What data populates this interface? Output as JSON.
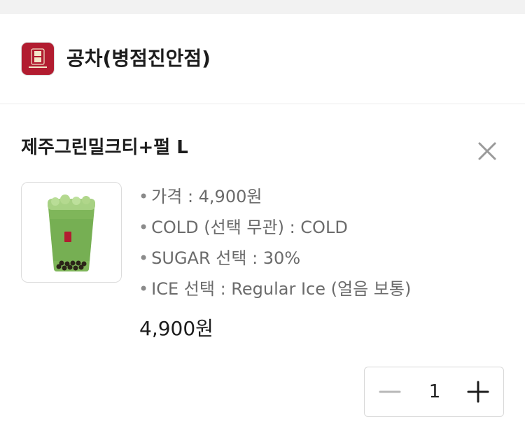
{
  "store": {
    "name": "공차(병점진안점)",
    "logo_icon": "gongcha-logo-icon",
    "brand_color": "#b21c30"
  },
  "cart_item": {
    "name": "제주그린밀크티+펄 L",
    "image_icon": "green-milk-tea-cup-icon",
    "options": [
      "가격 : 4,900원",
      "COLD (선택 무관) : COLD",
      "SUGAR 선택 : 30%",
      "ICE 선택 : Regular Ice (얼음 보통)"
    ],
    "price": "4,900원",
    "quantity": "1"
  },
  "icons": {
    "close": "close-icon",
    "minus": "minus-icon",
    "plus": "plus-icon"
  },
  "colors": {
    "divider": "#ececec",
    "option_text": "#6b6b6b",
    "text": "#1c1c1c"
  }
}
